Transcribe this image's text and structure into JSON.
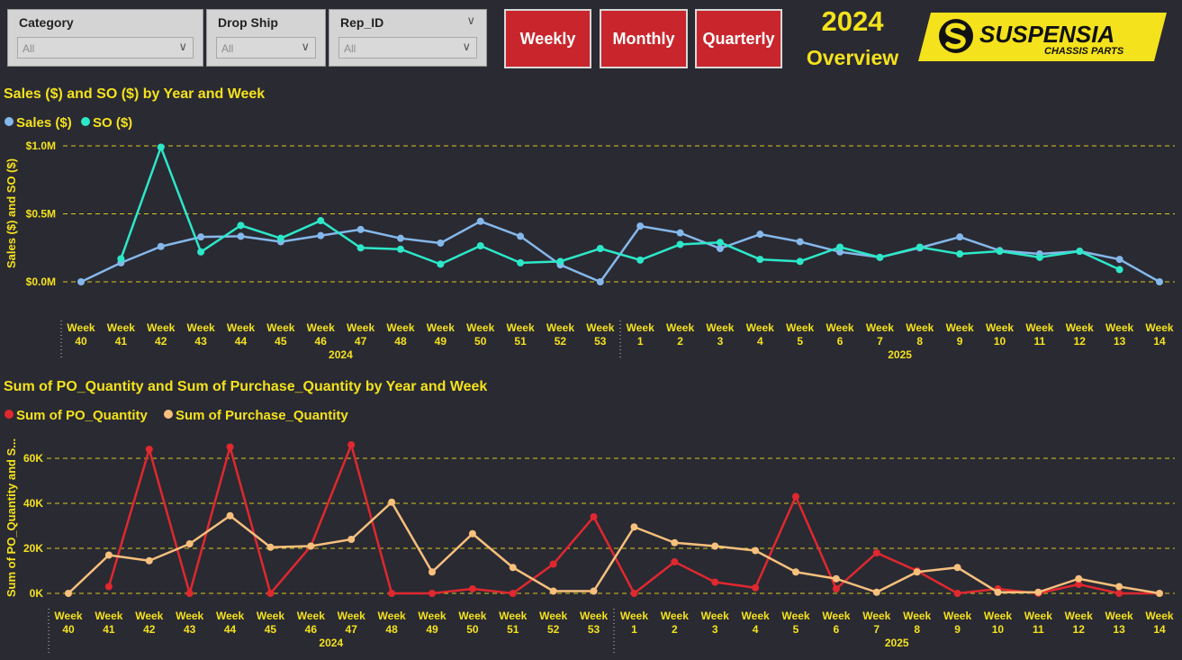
{
  "slicers": [
    {
      "label": "Category",
      "value": "All"
    },
    {
      "label": "Drop Ship",
      "value": "All"
    },
    {
      "label": "Rep_ID",
      "value": "All"
    }
  ],
  "buttons": {
    "weekly": "Weekly",
    "monthly": "Monthly",
    "quarterly": "Quarterly"
  },
  "header": {
    "year": "2024",
    "subtitle": "Overview"
  },
  "logo": {
    "brand": "SUSPENSIA",
    "tagline": "CHASSIS PARTS",
    "colors": {
      "background": "#f4e21c",
      "text": "#111111"
    }
  },
  "colors": {
    "page": "#2a2a33",
    "accent": "#f4e21c",
    "button": "#c8262c"
  },
  "chart_data": [
    {
      "type": "line",
      "title": "Sales ($) and SO ($) by Year and Week",
      "xlabel": "",
      "ylabel": "Sales ($) and SO ($)",
      "ylim": [
        0,
        1000000
      ],
      "yticks": [
        "$0.0M",
        "$0.5M",
        "$1.0M"
      ],
      "legend_position": "top-left",
      "grid": true,
      "categories": [
        "Week 40",
        "Week 41",
        "Week 42",
        "Week 43",
        "Week 44",
        "Week 45",
        "Week 46",
        "Week 47",
        "Week 48",
        "Week 49",
        "Week 50",
        "Week 51",
        "Week 52",
        "Week 53",
        "Week 1",
        "Week 2",
        "Week 3",
        "Week 4",
        "Week 5",
        "Week 6",
        "Week 7",
        "Week 8",
        "Week 9",
        "Week 10",
        "Week 11",
        "Week 12",
        "Week 13",
        "Week 14"
      ],
      "groups": [
        {
          "label": "2024",
          "count": 14
        },
        {
          "label": "2025",
          "count": 14
        }
      ],
      "series": [
        {
          "name": "Sales ($)",
          "color": "#85b8ea",
          "values": [
            0,
            140000,
            260000,
            330000,
            335000,
            295000,
            340000,
            385000,
            320000,
            285000,
            445000,
            335000,
            125000,
            0,
            410000,
            360000,
            245000,
            350000,
            295000,
            220000,
            180000,
            250000,
            330000,
            230000,
            205000,
            225000,
            165000,
            0
          ]
        },
        {
          "name": "SO ($)",
          "color": "#2ce8c8",
          "values": [
            null,
            170000,
            990000,
            220000,
            415000,
            320000,
            450000,
            250000,
            240000,
            130000,
            265000,
            140000,
            150000,
            245000,
            160000,
            275000,
            290000,
            165000,
            150000,
            255000,
            180000,
            255000,
            205000,
            225000,
            180000,
            225000,
            90000,
            null
          ]
        }
      ]
    },
    {
      "type": "line",
      "title": "Sum of PO_Quantity and Sum of Purchase_Quantity by Year and Week",
      "xlabel": "",
      "ylabel": "Sum of PO_Quantity and S...",
      "ylim": [
        0,
        60000
      ],
      "yticks": [
        "0K",
        "20K",
        "40K",
        "60K"
      ],
      "legend_position": "top-left",
      "grid": true,
      "categories": [
        "Week 40",
        "Week 41",
        "Week 42",
        "Week 43",
        "Week 44",
        "Week 45",
        "Week 46",
        "Week 47",
        "Week 48",
        "Week 49",
        "Week 50",
        "Week 51",
        "Week 52",
        "Week 53",
        "Week 1",
        "Week 2",
        "Week 3",
        "Week 4",
        "Week 5",
        "Week 6",
        "Week 7",
        "Week 8",
        "Week 9",
        "Week 10",
        "Week 11",
        "Week 12",
        "Week 13",
        "Week 14"
      ],
      "groups": [
        {
          "label": "2024",
          "count": 14
        },
        {
          "label": "2025",
          "count": 14
        }
      ],
      "series": [
        {
          "name": "Sum of PO_Quantity",
          "color": "#e0282e",
          "values": [
            null,
            3000,
            64000,
            0,
            65000,
            0,
            21000,
            66000,
            0,
            0,
            2000,
            0,
            13000,
            34000,
            0,
            14000,
            5000,
            2500,
            43000,
            2000,
            18000,
            10000,
            0,
            2000,
            0,
            4000,
            0,
            0
          ]
        },
        {
          "name": "Sum of Purchase_Quantity",
          "color": "#f7c07c",
          "values": [
            0,
            17000,
            14500,
            22000,
            34500,
            20500,
            21000,
            24000,
            40500,
            9500,
            26500,
            11500,
            1000,
            1000,
            29500,
            22500,
            21000,
            19000,
            9500,
            6500,
            500,
            9500,
            11500,
            500,
            500,
            6500,
            3000,
            0
          ]
        }
      ]
    }
  ]
}
